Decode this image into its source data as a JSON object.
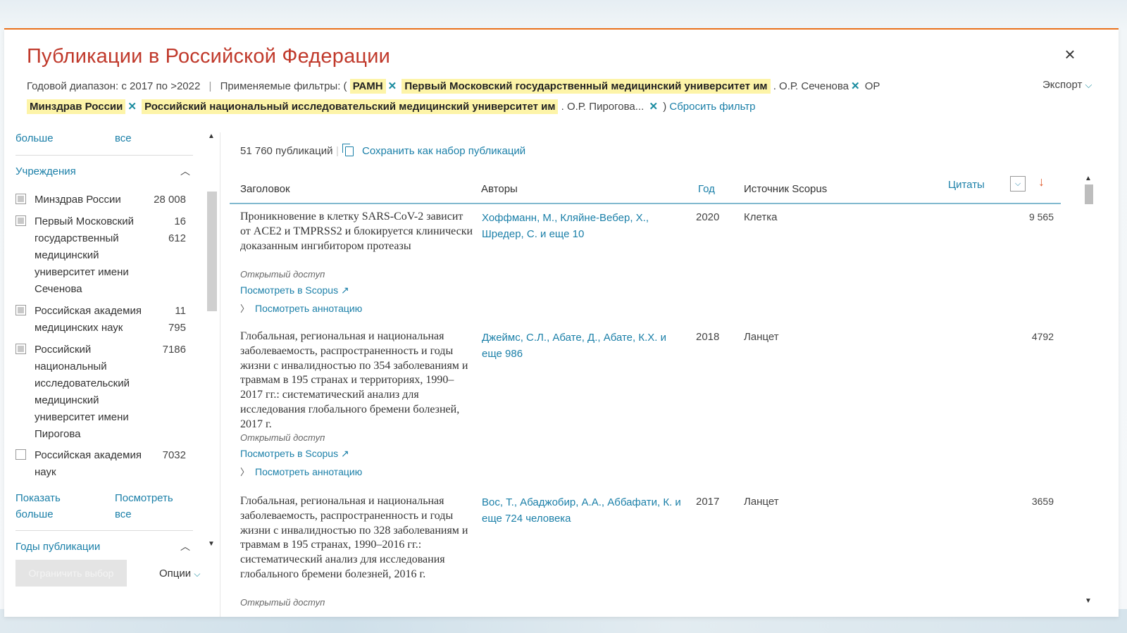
{
  "header": {
    "title": "Публикации в Российской Федерации",
    "close_icon": "×",
    "year_range": "Годовой диапазон: с 2017 по >2022",
    "filters_label": "Применяемые фильтры: (",
    "chips": [
      "РАМН",
      "Первый Московский государственный медицинский университет им",
      "Минздрав России",
      "Российский национальный исследовательский медицинский университет им"
    ],
    "chip_tail_1": ". О.Р. Сеченова",
    "or_word": "ОР",
    "chip_tail_2": ". О.Р. Пирогова...",
    "close_paren": ")",
    "reset": "Сбросить фильтр",
    "export": "Экспорт"
  },
  "sidebar": {
    "top_more": "больше",
    "top_all": "все",
    "institutions_title": "Учреждения",
    "institutions": [
      {
        "label": "Минздрав России",
        "count": "28 008",
        "checked": true
      },
      {
        "label": "Первый Московский государственный медицинский университет имени Сеченова",
        "count": "16 612",
        "checked": true
      },
      {
        "label": "Российская академия медицинских наук",
        "count": "11 795",
        "checked": true
      },
      {
        "label": "Российский национальный исследовательский медицинский университет имени Пирогова",
        "count": "7186",
        "checked": true
      },
      {
        "label": "Российская академия наук",
        "count": "7032",
        "checked": false
      }
    ],
    "show_more": "Показать больше",
    "view_all": "Посмотреть все",
    "years_title": "Годы публикации",
    "limit_button": "Ограничить  выбор",
    "options": "Опции"
  },
  "main": {
    "count": "51 760 публикаций",
    "save_set": "Сохранить как набор публикаций",
    "columns": {
      "title": "Заголовок",
      "authors": "Авторы",
      "year": "Год",
      "source": "Источник Scopus",
      "citations": "Цитаты"
    },
    "rows": [
      {
        "title": "Проникновение в клетку SARS-CoV-2 зависит от ACE2 и TMPRSS2 и блокируется клинически доказанным ингибитором протеазы",
        "open_access": "Открытый доступ",
        "view_scopus": "Посмотреть в Scopus ↗",
        "view_abstract": "Посмотреть аннотацию",
        "authors": "Хоффманн, М., Кляйне-Вебер, Х., Шредер, С. и еще 10",
        "year": "2020",
        "source": "Клетка",
        "citations": "9 565"
      },
      {
        "title": "Глобальная, региональная и национальная заболеваемость, распространенность и годы жизни с инвалидностью по 354 заболеваниям и травмам в 195 странах и территориях, 1990–2017 гг.: систематический анализ для исследования глобального бремени болезней, 2017 г.",
        "open_access": "Открытый доступ",
        "view_scopus": "Посмотреть в Scopus ↗",
        "view_abstract": "Посмотреть аннотацию",
        "authors": "Джеймс, С.Л., Абате, Д., Абате, К.Х. и еще 986",
        "year": "2018",
        "source": "Ланцет",
        "citations": "4792"
      },
      {
        "title": "Глобальная, региональная и национальная заболеваемость, распространенность и годы жизни с инвалидностью по 328 заболеваниям и травмам в 195 странах, 1990–2016 гг.: систематический анализ для исследования глобального бремени болезней, 2016 г.",
        "open_access": "Открытый доступ",
        "authors": "Вос, Т., Абаджобир, А.А., Аббафати, К. и еще 724 человека",
        "year": "2017",
        "source": "Ланцет",
        "citations": "3659"
      }
    ]
  },
  "colors": {
    "title": "#c0392b",
    "link": "#1a7fa8",
    "chip": "#fdf4a8",
    "accent": "#e9711c"
  }
}
